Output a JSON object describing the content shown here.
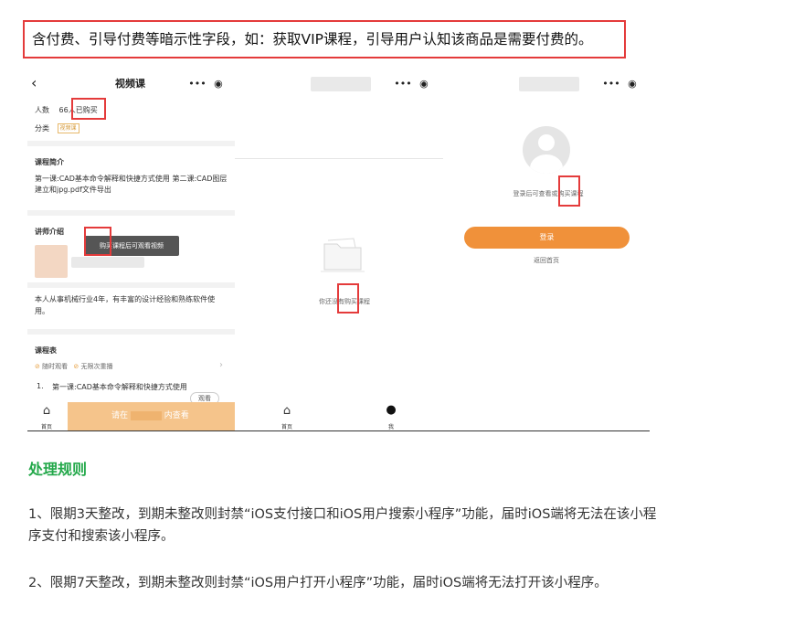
{
  "callout_text": "含付费、引导付费等暗示性字段，如：获取VIP课程，引导用户认知该商品是需要付费的。",
  "panel1": {
    "back_glyph": "‹",
    "nav_title": "视频课",
    "capsule_more": "•••",
    "capsule_close": "◉",
    "people_label": "人数",
    "people_value": "66人已购买",
    "category_label": "分类",
    "category_tag": "视频课",
    "intro_title": "课程简介",
    "intro_text": "第一课:CAD基本命令解释和快捷方式使用 第二课:CAD图层建立和jpg.pdf文件导出",
    "teacher_title": "讲师介绍",
    "tooltip": "购买课程后可观看视频",
    "teacher_bio": "本人从事机械行业4年，有丰富的设计经验和熟练软件使用。",
    "schedule_title": "课程表",
    "feature1": "随时观看",
    "feature2": "无限次重播",
    "lesson_no": "1.",
    "lesson_text": "第一课:CAD基本命令解释和快捷方式使用",
    "watch_button": "观看",
    "tab_home": "首页",
    "buy_prefix": "请在",
    "buy_suffix": "内查看"
  },
  "panel2": {
    "capsule_more": "•••",
    "capsule_close": "◉",
    "empty_text": "你还没有购买课程",
    "tab_home": "首页",
    "tab_me": "我"
  },
  "panel3": {
    "capsule_more": "•••",
    "capsule_close": "◉",
    "login_hint": "登录后可查看或购买课程",
    "login_button": "登录",
    "back_home": "返回首页"
  },
  "rules_title": "处理规则",
  "rule1": "1、限期3天整改，到期未整改则封禁“iOS支付接口和iOS用户搜索小程序”功能，届时iOS端将无法在该小程序支付和搜索该小程序。",
  "rule2": "2、限期7天整改，到期未整改则封禁“iOS用户打开小程序”功能，届时iOS端将无法打开该小程序。",
  "colors": {
    "highlight": "#e43b3b",
    "accent_orange": "#f0913a",
    "title_green": "#23a84a"
  }
}
